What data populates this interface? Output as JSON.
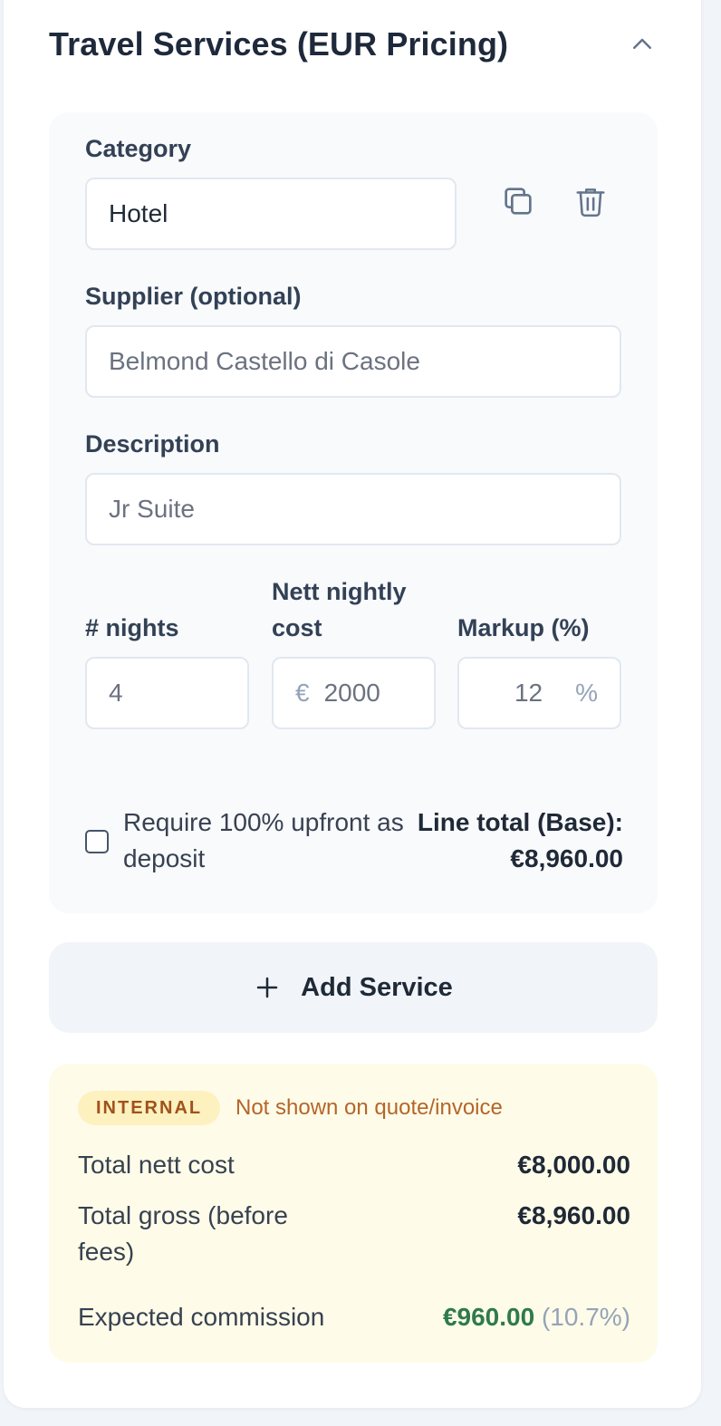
{
  "section": {
    "title": "Travel Services (EUR Pricing)"
  },
  "service": {
    "category_label": "Category",
    "category_value": "Hotel",
    "supplier_label": "Supplier (optional)",
    "supplier_value": "Belmond Castello di Casole",
    "description_label": "Description",
    "description_value": "Jr Suite",
    "nights_label": "# nights",
    "nights_value": "4",
    "nett_label": "Nett nightly cost",
    "currency_symbol": "€",
    "nett_value": "2000",
    "markup_label": "Markup (%)",
    "markup_value": "12",
    "percent_symbol": "%",
    "deposit_label": "Require 100% upfront as deposit",
    "deposit_checked": false,
    "line_total_label": "Line total (Base):",
    "line_total_value": "€8,960.00",
    "icons": [
      "copy-icon",
      "trash-icon"
    ]
  },
  "add_service": {
    "label": "Add Service",
    "icon": "plus-icon"
  },
  "internal": {
    "badge": "INTERNAL",
    "note": "Not shown on quote/invoice",
    "nett_label": "Total nett cost",
    "nett_value": "€8,000.00",
    "gross_label": "Total gross (before fees)",
    "gross_value": "€8,960.00",
    "commission_label": "Expected commission",
    "commission_value": "€960.00",
    "commission_pct": "(10.7%)"
  },
  "colors": {
    "accent_green": "#2f7a4d",
    "badge_bg": "#fdf1c0",
    "badge_text": "#a1521a",
    "internal_bg": "#fefce8"
  }
}
